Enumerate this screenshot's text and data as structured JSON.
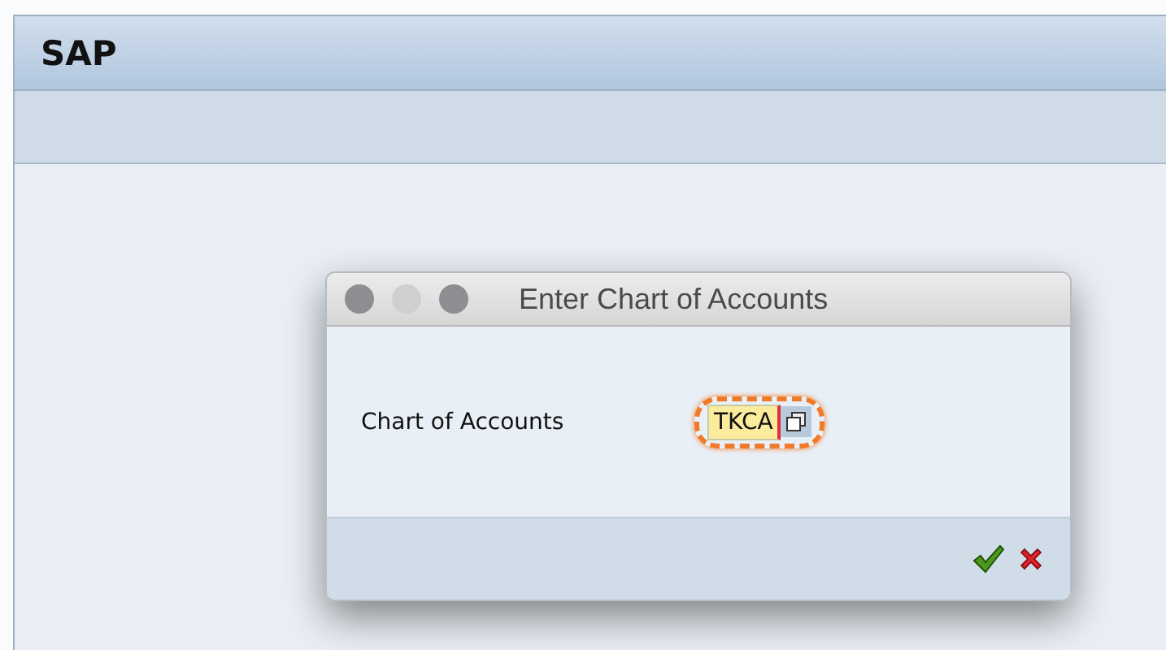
{
  "window": {
    "title": "SAP"
  },
  "dialog": {
    "title": "Enter Chart of Accounts",
    "field": {
      "label": "Chart of Accounts",
      "value": "TKCA",
      "highlighted": true
    },
    "buttons": [
      {
        "kind": "confirm"
      },
      {
        "kind": "cancel"
      }
    ]
  }
}
